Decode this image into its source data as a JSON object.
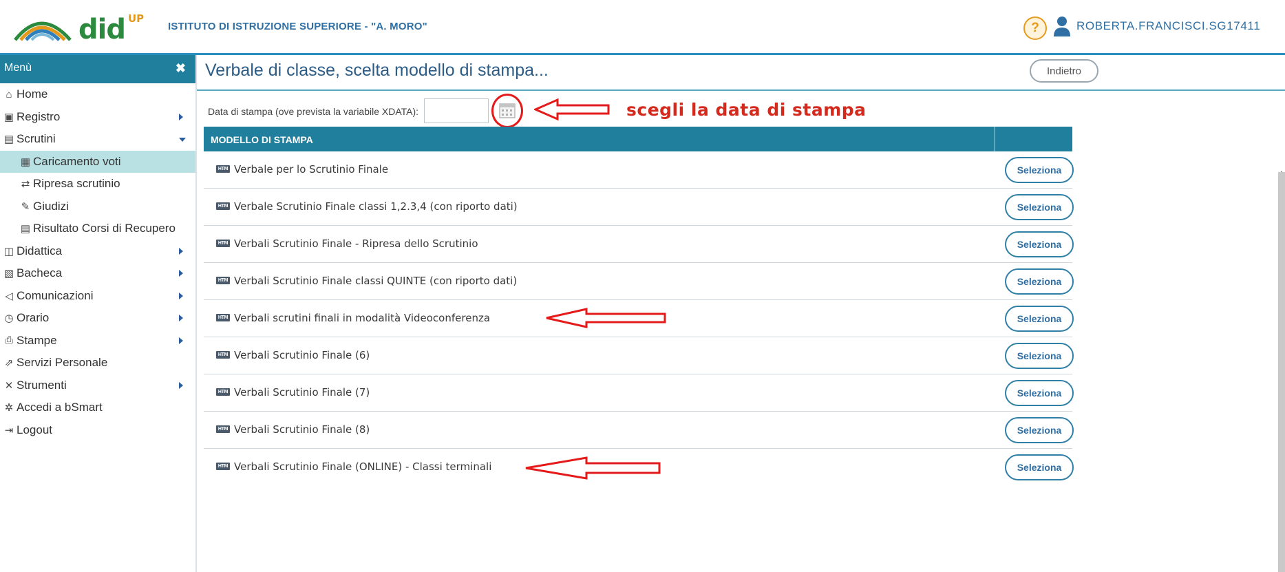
{
  "header": {
    "logo_text": "did",
    "logo_sup": "UP",
    "school_name": "ISTITUTO DI ISTRUZIONE SUPERIORE - \"A. MORO\"",
    "help_label": "?",
    "user_name": "ROBERTA.FRANCISCI.SG17411"
  },
  "sidebar": {
    "title": "Menù",
    "close_label": "✖",
    "items": [
      {
        "label": "Home",
        "icon": "home-icon"
      },
      {
        "label": "Registro",
        "icon": "calendar-check-icon"
      },
      {
        "label": "Scrutini",
        "icon": "document-icon"
      },
      {
        "label": "Caricamento voti",
        "icon": "grid-icon"
      },
      {
        "label": "Ripresa scrutinio",
        "icon": "retweet-icon"
      },
      {
        "label": "Giudizi",
        "icon": "edit-icon"
      },
      {
        "label": "Risultato Corsi di Recupero",
        "icon": "document-icon"
      },
      {
        "label": "Didattica",
        "icon": "book-icon"
      },
      {
        "label": "Bacheca",
        "icon": "newspaper-icon"
      },
      {
        "label": "Comunicazioni",
        "icon": "megaphone-icon"
      },
      {
        "label": "Orario",
        "icon": "clock-icon"
      },
      {
        "label": "Stampe",
        "icon": "printer-icon"
      },
      {
        "label": "Servizi Personale",
        "icon": "share-icon"
      },
      {
        "label": "Strumenti",
        "icon": "tools-icon"
      },
      {
        "label": "Accedi a bSmart",
        "icon": "bsmart-icon"
      },
      {
        "label": "Logout",
        "icon": "logout-icon"
      }
    ]
  },
  "main": {
    "title": "Verbale di classe, scelta modello di stampa...",
    "back_label": "Indietro",
    "date_label": "Data di stampa (ove prevista la variabile XDATA):",
    "date_value": "",
    "annotation": "scegli la data di stampa",
    "table_header": "MODELLO DI STAMPA",
    "file_icon_text": "HTM",
    "select_label": "Seleziona",
    "rows": [
      "Verbale per lo Scrutinio Finale",
      "Verbale Scrutinio Finale classi 1,2.3,4 (con riporto dati)",
      "Verbali Scrutinio Finale - Ripresa dello Scrutinio",
      "Verbali Scrutinio Finale classi QUINTE (con riporto dati)",
      "Verbali scrutini finali in modalità Videoconferenza",
      "Verbali Scrutinio Finale (6)",
      "Verbali Scrutinio Finale (7)",
      "Verbali Scrutinio Finale (8)",
      "Verbali Scrutinio Finale (ONLINE) - Classi terminali"
    ]
  },
  "colors": {
    "header_bar": "#1f7f9d",
    "accent_text": "#2f6fa3",
    "annotation_red": "#e51b1b",
    "active_item_bg": "#b9e0e3"
  }
}
